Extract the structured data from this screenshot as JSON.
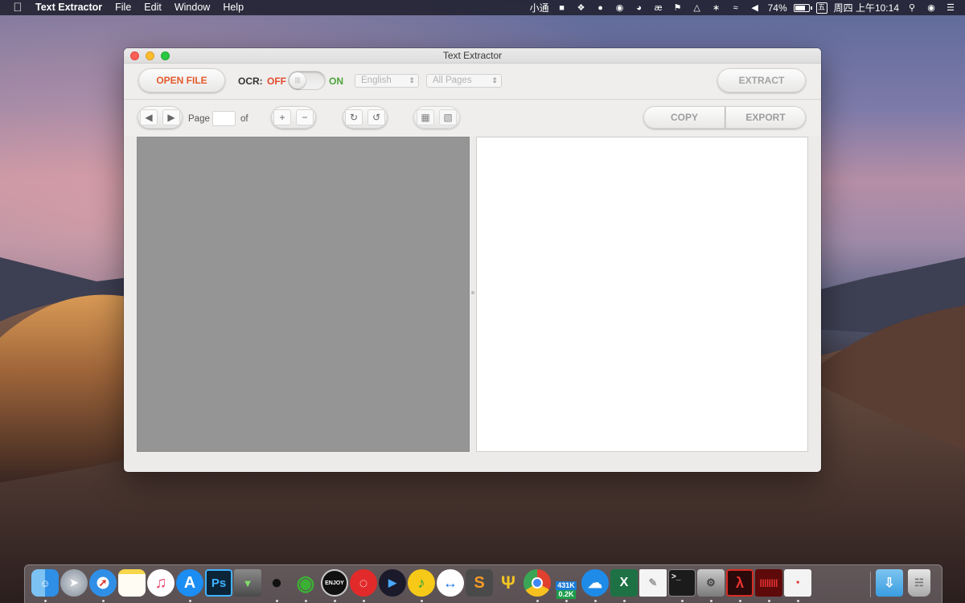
{
  "menubar": {
    "app_name": "Text Extractor",
    "menus": [
      "File",
      "Edit",
      "Window",
      "Help"
    ],
    "status": {
      "input_method": "小通",
      "battery": "74%",
      "ime_box": "五",
      "clock": "周四 上午10:14"
    }
  },
  "window": {
    "title": "Text Extractor",
    "toolbar": {
      "open_file": "OPEN FILE",
      "ocr_label": "OCR:",
      "ocr_off": "OFF",
      "ocr_on": "ON",
      "language": "English",
      "pages": "All Pages",
      "extract": "EXTRACT"
    },
    "navbar": {
      "page_label": "Page",
      "page_value": "",
      "of_label": "of",
      "zoom_in": "+",
      "zoom_out": "−",
      "copy": "COPY",
      "export": "EXPORT"
    }
  },
  "dock": {
    "netspeed_up": "431K",
    "netspeed_down": "0.2K",
    "items": [
      "finder",
      "launchpad",
      "safari",
      "notes",
      "itunes",
      "app-store",
      "photoshop",
      "archive",
      "qq",
      "wechat",
      "enjoy",
      "netease-music",
      "infuse",
      "qq-music",
      "teamviewer",
      "sublime",
      "qbittorrent",
      "chrome",
      "netspeed",
      "icloud",
      "excel",
      "textedit",
      "terminal",
      "disk-utility",
      "acrobat",
      "audio",
      "text-extractor",
      "downloads",
      "trash"
    ]
  },
  "colors": {
    "accent_open": "#e35a2b",
    "ocr_off": "#e24a2c",
    "ocr_on": "#4da33a"
  }
}
